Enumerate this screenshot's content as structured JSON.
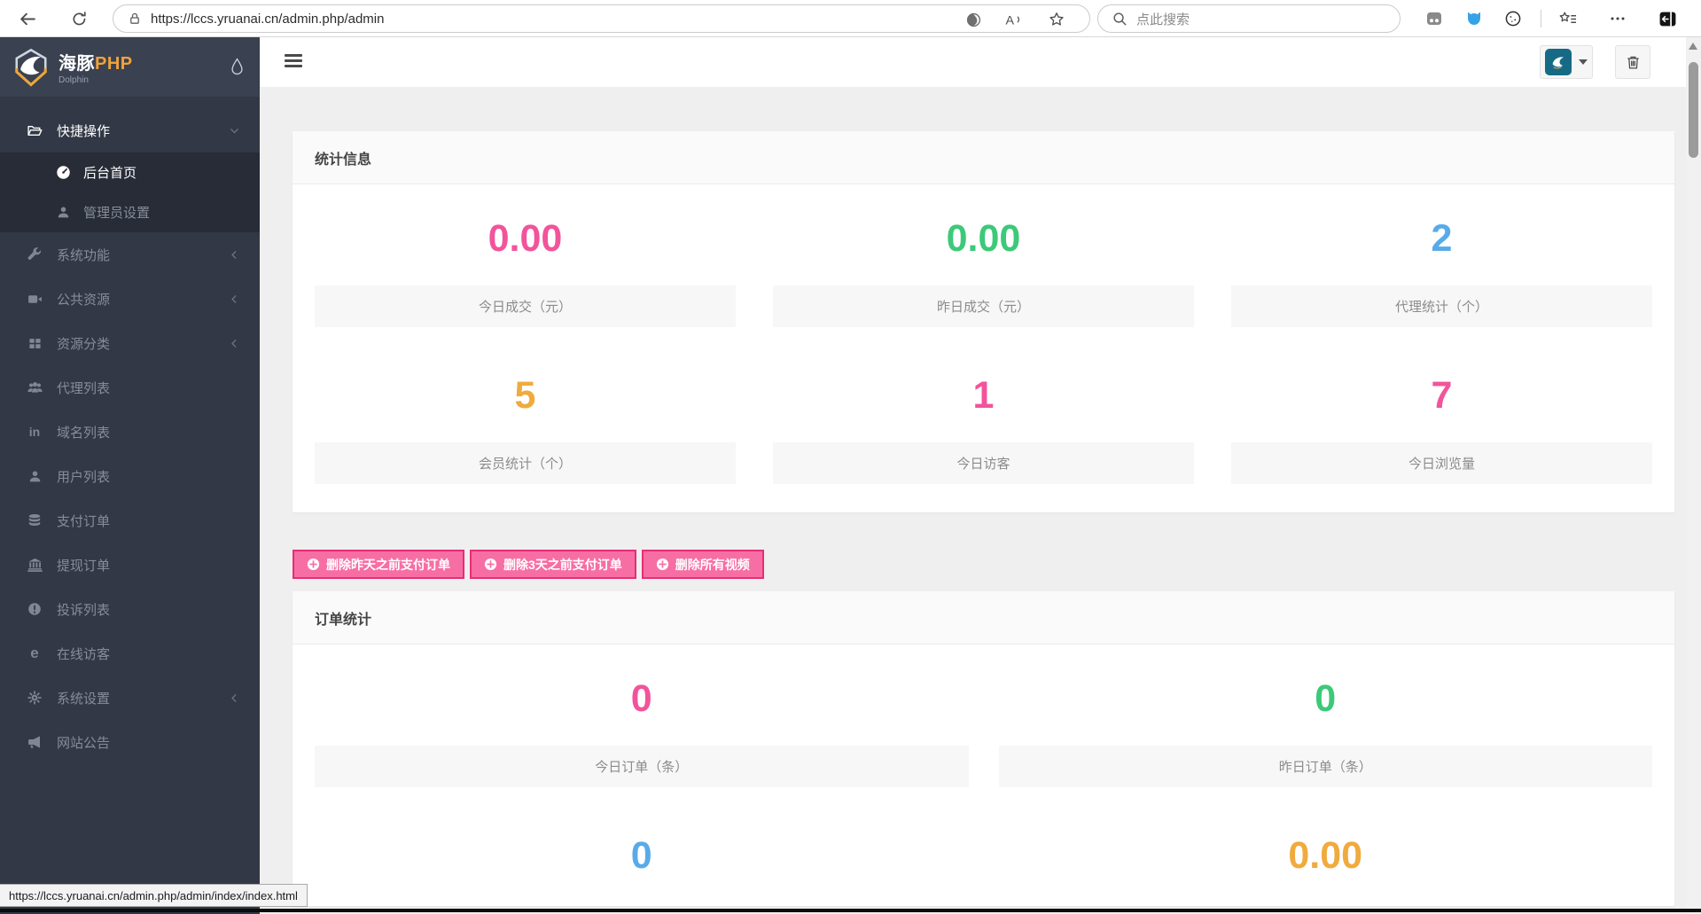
{
  "browser": {
    "url": "https://lccs.yruanai.cn/admin.php/admin",
    "search_placeholder": "点此搜索",
    "status_bar_url": "https://lccs.yruanai.cn/admin.php/admin/index/index.html"
  },
  "sidebar": {
    "logo_title": "海豚",
    "logo_title_accent": "PHP",
    "logo_subtitle": "Dolphin",
    "items": [
      {
        "label": "快捷操作",
        "icon": "folder-open-icon",
        "arrow": "down"
      },
      {
        "label": "后台首页",
        "icon": "dashboard-icon",
        "active": true,
        "sub": true
      },
      {
        "label": "管理员设置",
        "icon": "user-icon",
        "sub": true
      },
      {
        "label": "系统功能",
        "icon": "wrench-icon",
        "arrow": "left"
      },
      {
        "label": "公共资源",
        "icon": "video-icon",
        "arrow": "left"
      },
      {
        "label": "资源分类",
        "icon": "grid-icon",
        "arrow": "left"
      },
      {
        "label": "代理列表",
        "icon": "users-icon"
      },
      {
        "label": "域名列表",
        "icon": "linkedin-icon"
      },
      {
        "label": "用户列表",
        "icon": "user-icon"
      },
      {
        "label": "支付订单",
        "icon": "database-icon"
      },
      {
        "label": "提现订单",
        "icon": "bank-icon"
      },
      {
        "label": "投诉列表",
        "icon": "warning-icon"
      },
      {
        "label": "在线访客",
        "icon": "edge-icon"
      },
      {
        "label": "系统设置",
        "icon": "gear-icon",
        "arrow": "left"
      },
      {
        "label": "网站公告",
        "icon": "megaphone-icon"
      }
    ]
  },
  "stats_card": {
    "title": "统计信息",
    "stats": [
      {
        "value": "0.00",
        "label": "今日成交（元）",
        "color": "#f2549b"
      },
      {
        "value": "0.00",
        "label": "昨日成交（元）",
        "color": "#3cc979"
      },
      {
        "value": "2",
        "label": "代理统计（个）",
        "color": "#58abe8"
      },
      {
        "value": "5",
        "label": "会员统计（个）",
        "color": "#f0ab3e"
      },
      {
        "value": "1",
        "label": "今日访客",
        "color": "#f2549b"
      },
      {
        "value": "7",
        "label": "今日浏览量",
        "color": "#f2549b"
      }
    ]
  },
  "actions": {
    "button_color": "#f76ea5",
    "button_border_color": "#e82d74",
    "buttons": [
      {
        "label": "删除昨天之前支付订单"
      },
      {
        "label": "删除3天之前支付订单"
      },
      {
        "label": "删除所有视频"
      }
    ]
  },
  "orders_card": {
    "title": "订单统计",
    "stats": [
      {
        "value": "0",
        "label": "今日订单（条）",
        "color": "#f2549b"
      },
      {
        "value": "0",
        "label": "昨日订单（条）",
        "color": "#3cc979"
      },
      {
        "value": "0",
        "color": "#58abe8"
      },
      {
        "value": "0.00",
        "color": "#f0ab3e"
      }
    ]
  }
}
